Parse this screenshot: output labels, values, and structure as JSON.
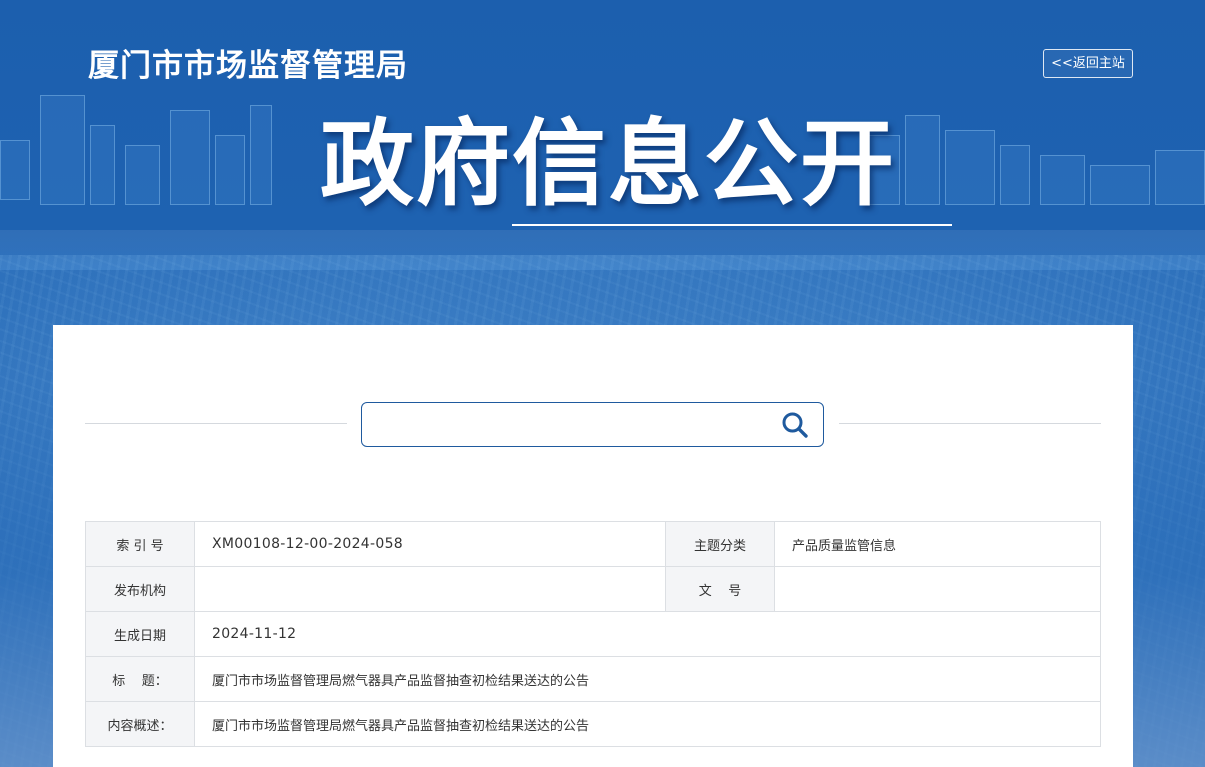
{
  "header": {
    "site_title": "厦门市市场监督管理局",
    "back_label": "<<返回主站",
    "hero_title": "政府信息公开"
  },
  "search": {
    "value": "",
    "placeholder": ""
  },
  "info": {
    "index_label": "索 引 号",
    "index_value": "XM00108-12-00-2024-058",
    "category_label": "主题分类",
    "category_value": "产品质量监管信息",
    "publisher_label": "发布机构",
    "publisher_value": "",
    "docno_label": "文    号",
    "docno_value": "",
    "date_label": "生成日期",
    "date_value": "2024-11-12",
    "title_label": "标    题：",
    "title_value": "厦门市市场监督管理局燃气器具产品监督抽查初检结果送达的公告",
    "summary_label": "内容概述：",
    "summary_value": "厦门市市场监督管理局燃气器具产品监督抽查初检结果送达的公告"
  },
  "colors": {
    "banner": "#1c5fae",
    "search_border": "#1f5a9e",
    "label_bg": "#f4f5f7"
  }
}
